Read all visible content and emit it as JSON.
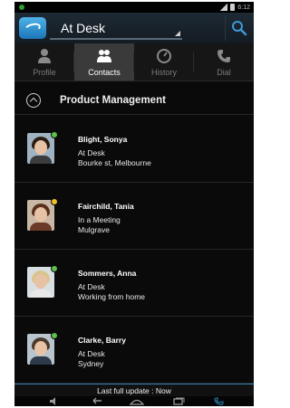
{
  "presence": {
    "status_label": "At Desk"
  },
  "tabs": [
    {
      "label": "Profile",
      "icon": "person-icon",
      "active": false
    },
    {
      "label": "Contacts",
      "icon": "contacts-icon",
      "active": true
    },
    {
      "label": "History",
      "icon": "clock-icon",
      "active": false
    },
    {
      "label": "Dial",
      "icon": "phone-icon",
      "active": false
    }
  ],
  "group": {
    "title": "Product Management"
  },
  "contacts": [
    {
      "name": "Blight, Sonya",
      "status": "At Desk",
      "location": "Bourke st, Melbourne",
      "presence_color": "#5cc24a"
    },
    {
      "name": "Fairchild, Tania",
      "status": "In a Meeting",
      "location": "Mulgrave",
      "presence_color": "#f0c02c"
    },
    {
      "name": "Sommers, Anna",
      "status": "At Desk",
      "location": "Working from home",
      "presence_color": "#5cc24a"
    },
    {
      "name": "Clarke, Barry",
      "status": "At Desk",
      "location": "Sydney",
      "presence_color": "#5cc24a"
    }
  ],
  "footer": {
    "update_text": "Last full update : Now"
  },
  "colors": {
    "accent": "#2e7fb0",
    "available": "#5cc24a",
    "busy": "#f0c02c"
  }
}
